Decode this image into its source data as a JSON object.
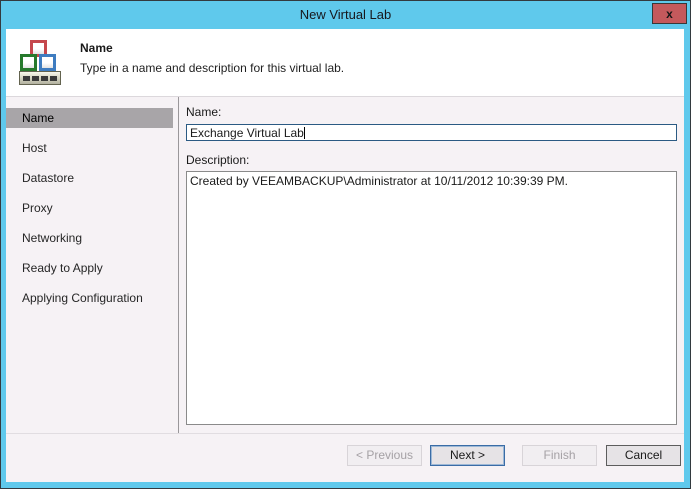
{
  "window": {
    "title": "New Virtual Lab",
    "close_label": "x"
  },
  "header": {
    "title": "Name",
    "subtitle": "Type in a name and description for this virtual lab."
  },
  "sidebar": {
    "items": [
      {
        "label": "Name",
        "active": true
      },
      {
        "label": "Host",
        "active": false
      },
      {
        "label": "Datastore",
        "active": false
      },
      {
        "label": "Proxy",
        "active": false
      },
      {
        "label": "Networking",
        "active": false
      },
      {
        "label": "Ready to Apply",
        "active": false
      },
      {
        "label": "Applying Configuration",
        "active": false
      }
    ]
  },
  "form": {
    "name_label": "Name:",
    "name_value": "Exchange Virtual Lab",
    "description_label": "Description:",
    "description_value": "Created by VEEAMBACKUP\\Administrator at 10/11/2012 10:39:39 PM."
  },
  "footer": {
    "buttons": [
      {
        "label": "< Previous",
        "state": "disabled"
      },
      {
        "label": "Next >",
        "state": "default"
      },
      {
        "label": "Finish",
        "state": "disabled"
      },
      {
        "label": "Cancel",
        "state": "enabled"
      }
    ]
  },
  "colors": {
    "frame_blue": "#5fc9ec",
    "close_red": "#c4595c",
    "body_bg": "#f6f2f5",
    "selected_step_bg": "#a8a5a8",
    "focused_input_border": "#2b5a83",
    "default_button_border": "#3a6ca6"
  }
}
